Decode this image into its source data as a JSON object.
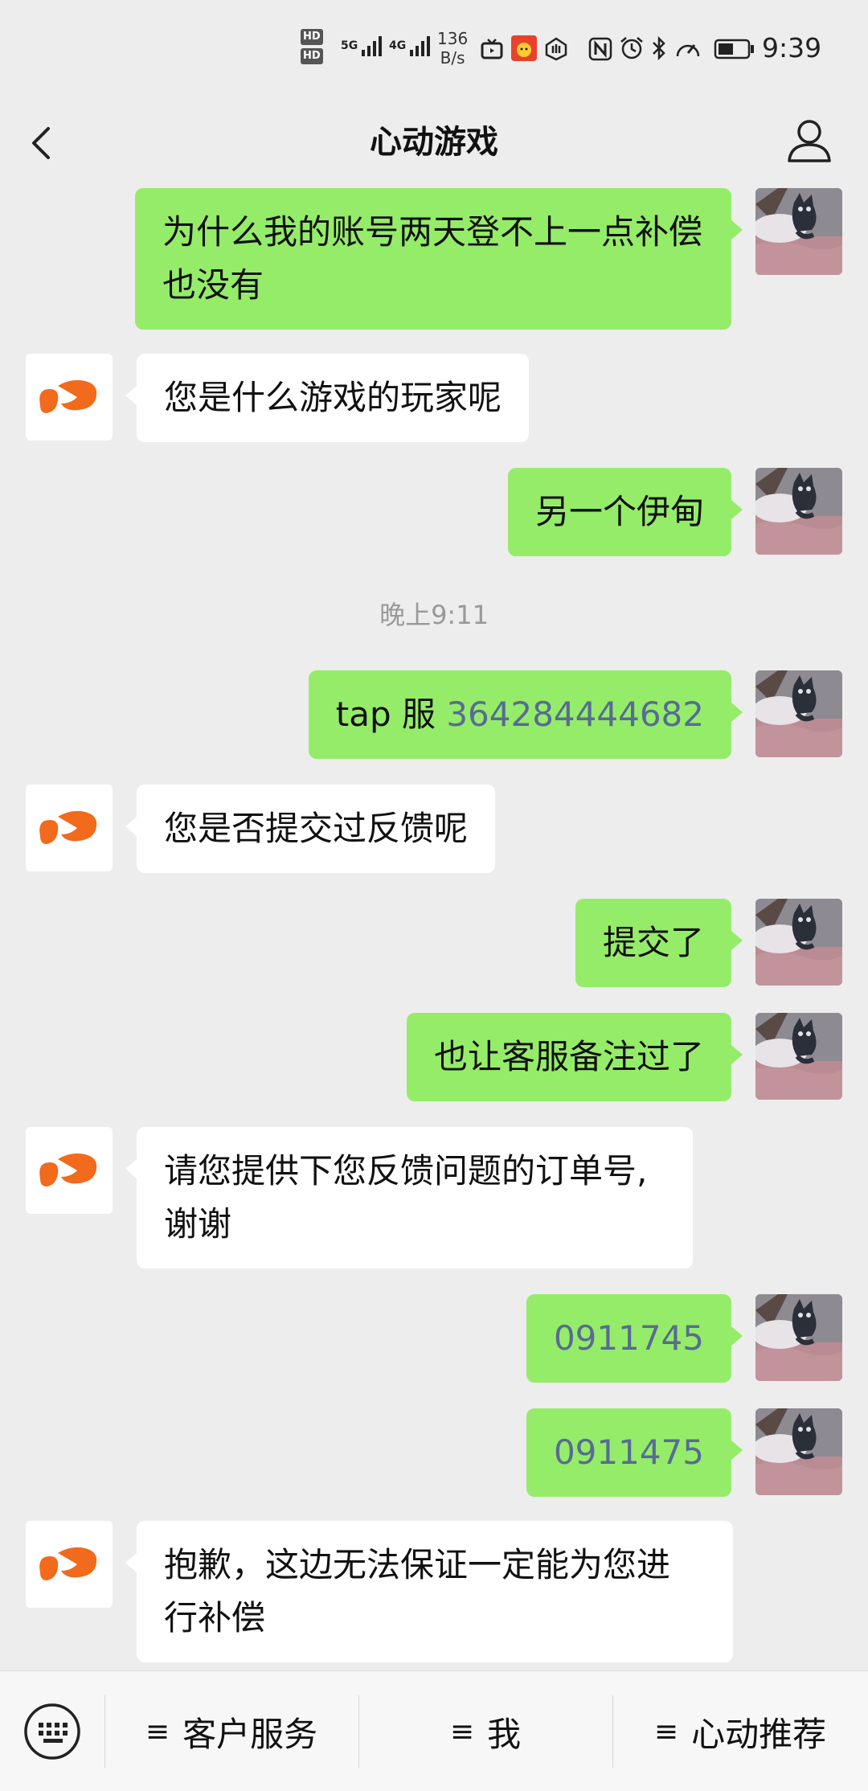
{
  "status_bar": {
    "time": "9:39",
    "speed_value": "136",
    "speed_unit": "B/s",
    "hd1": "HD",
    "hd2": "HD",
    "net1": "5G",
    "net2": "4G"
  },
  "header": {
    "title": "心动游戏"
  },
  "messages": [
    {
      "side": "right",
      "text": "为什么我的账号两天登不上一点补偿也没有"
    },
    {
      "side": "left",
      "text": "您是什么游戏的玩家呢"
    },
    {
      "side": "right",
      "text": "另一个伊甸"
    },
    {
      "timestamp": "晚上9:11"
    },
    {
      "side": "right",
      "prefix": "tap 服 ",
      "number": "364284444682"
    },
    {
      "side": "left",
      "text": "您是否提交过反馈呢"
    },
    {
      "side": "right",
      "text": "提交了"
    },
    {
      "side": "right",
      "text": "也让客服备注过了"
    },
    {
      "side": "left",
      "line1": "请您提供下您反馈问题的订单号,",
      "line2": "谢谢"
    },
    {
      "side": "right",
      "number": "0911745"
    },
    {
      "side": "right",
      "number": "0911475"
    },
    {
      "side": "left",
      "line1": "抱歉，这边无法保证一定能为您进",
      "line2": "行补偿"
    }
  ],
  "bottom_menu": {
    "items": [
      {
        "icon": "≡",
        "label": "客户服务"
      },
      {
        "icon": "≡",
        "label": "我"
      },
      {
        "icon": "≡",
        "label": "心动推荐"
      }
    ]
  },
  "colors": {
    "sent_bubble": "#95ec69",
    "received_bubble": "#ffffff",
    "background": "#ededed",
    "link_number": "#576b95",
    "brand_orange": "#f26a1b"
  },
  "icons": {
    "back": "back-arrow-icon",
    "user": "user-profile-icon",
    "keyboard": "keyboard-icon",
    "brand": "xd-brand-logo"
  }
}
